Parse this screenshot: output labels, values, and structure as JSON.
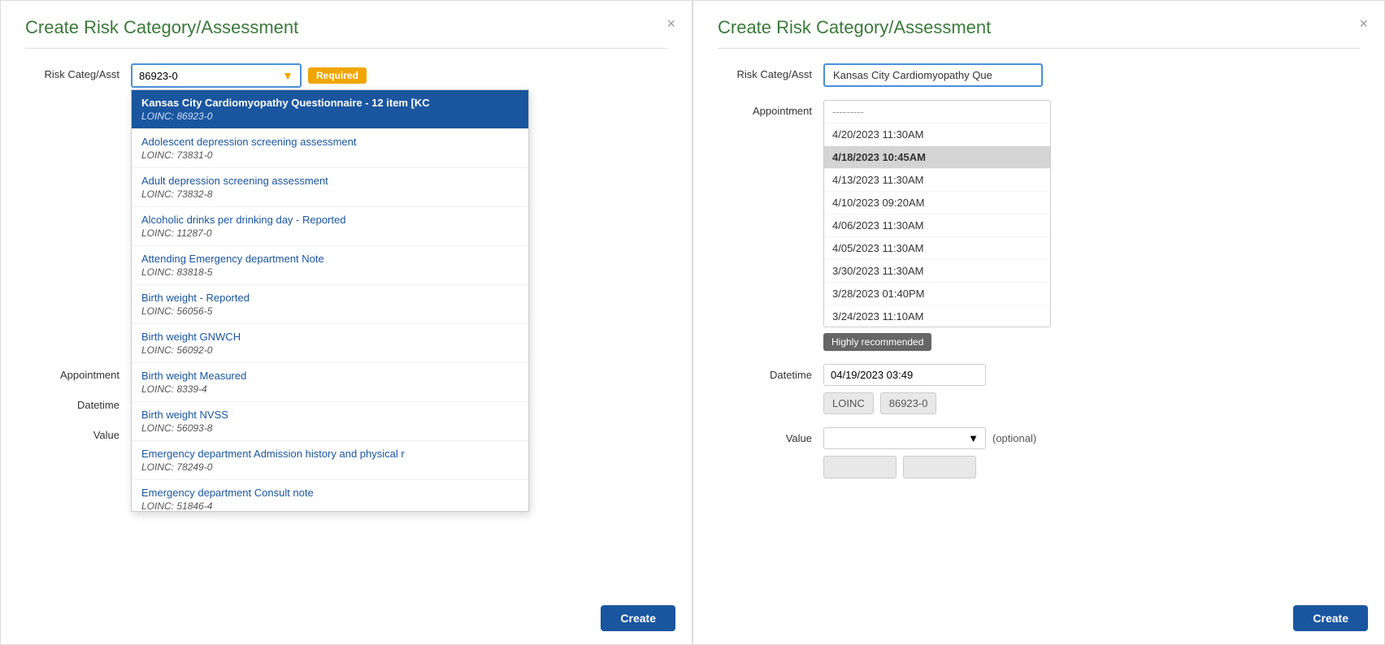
{
  "left_panel": {
    "title": "Create Risk Category/Assessment",
    "close_icon": "×",
    "risk_label": "Risk Categ/Asst",
    "risk_value": "86923-0",
    "required_badge": "Required",
    "appointment_label": "Appointment",
    "datetime_label": "Datetime",
    "value_label": "Value",
    "dropdown_items": [
      {
        "name": "Kansas City Cardiomyopathy Questionnaire - 12 item [KC",
        "loinc": "LOINC: 86923-0",
        "selected": true
      },
      {
        "name": "Adolescent depression screening assessment",
        "loinc": "LOINC: 73831-0",
        "selected": false
      },
      {
        "name": "Adult depression screening assessment",
        "loinc": "LOINC: 73832-8",
        "selected": false
      },
      {
        "name": "Alcoholic drinks per drinking day - Reported",
        "loinc": "LOINC: 11287-0",
        "selected": false
      },
      {
        "name": "Attending Emergency department Note",
        "loinc": "LOINC: 83818-5",
        "selected": false
      },
      {
        "name": "Birth weight - Reported",
        "loinc": "LOINC: 56056-5",
        "selected": false
      },
      {
        "name": "Birth weight GNWCH",
        "loinc": "LOINC: 56092-0",
        "selected": false
      },
      {
        "name": "Birth weight Measured",
        "loinc": "LOINC: 8339-4",
        "selected": false
      },
      {
        "name": "Birth weight NVSS",
        "loinc": "LOINC: 56093-8",
        "selected": false
      },
      {
        "name": "Emergency department Admission history and physical r",
        "loinc": "LOINC: 78249-0",
        "selected": false
      },
      {
        "name": "Emergency department Consult note",
        "loinc": "LOINC: 51846-4",
        "selected": false
      }
    ],
    "create_button": "Create"
  },
  "right_panel": {
    "title": "Create Risk Category/Assessment",
    "close_icon": "×",
    "risk_label": "Risk Categ/Asst",
    "risk_value": "Kansas City Cardiomyopathy Que",
    "appointment_label": "Appointment",
    "datetime_label": "Datetime",
    "datetime_value": "04/19/2023 03:49",
    "value_label": "Value",
    "optional_text": "(optional)",
    "highly_recommended": "Highly recommended",
    "loinc_label": "LOINC",
    "loinc_value": "86923-0",
    "appointments": [
      {
        "text": "---------",
        "selected": false,
        "placeholder": true
      },
      {
        "text": "4/20/2023 11:30AM",
        "selected": false,
        "placeholder": false
      },
      {
        "text": "4/18/2023 10:45AM",
        "selected": true,
        "placeholder": false
      },
      {
        "text": "4/13/2023 11:30AM",
        "selected": false,
        "placeholder": false
      },
      {
        "text": "4/10/2023 09:20AM",
        "selected": false,
        "placeholder": false
      },
      {
        "text": "4/06/2023 11:30AM",
        "selected": false,
        "placeholder": false
      },
      {
        "text": "4/05/2023 11:30AM",
        "selected": false,
        "placeholder": false
      },
      {
        "text": "3/30/2023 11:30AM",
        "selected": false,
        "placeholder": false
      },
      {
        "text": "3/28/2023 01:40PM",
        "selected": false,
        "placeholder": false
      },
      {
        "text": "3/24/2023 11:10AM",
        "selected": false,
        "placeholder": false
      }
    ],
    "create_button": "Create"
  }
}
